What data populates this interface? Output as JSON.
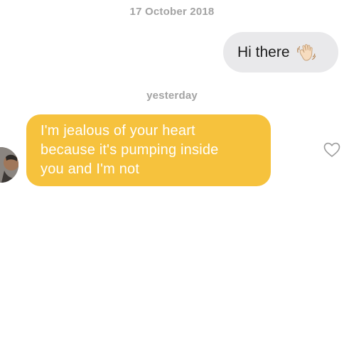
{
  "conversation": {
    "dates": [
      "17 October 2018",
      "yesterday"
    ],
    "outgoing": {
      "text": "Hi there",
      "emoji_icon": "waving-hand-icon"
    },
    "incoming": {
      "lines": [
        "I'm jealous of your heart",
        "because it's pumping inside",
        "you and I'm not"
      ],
      "avatar_icon": "avatar",
      "like_icon": "heart-outline-icon"
    }
  },
  "colors": {
    "outgoing_bubble": "#e9e9eb",
    "incoming_bubble": "#f6c23d",
    "date_text": "#a3a3a3",
    "heart_outline": "#9b9b9b"
  }
}
